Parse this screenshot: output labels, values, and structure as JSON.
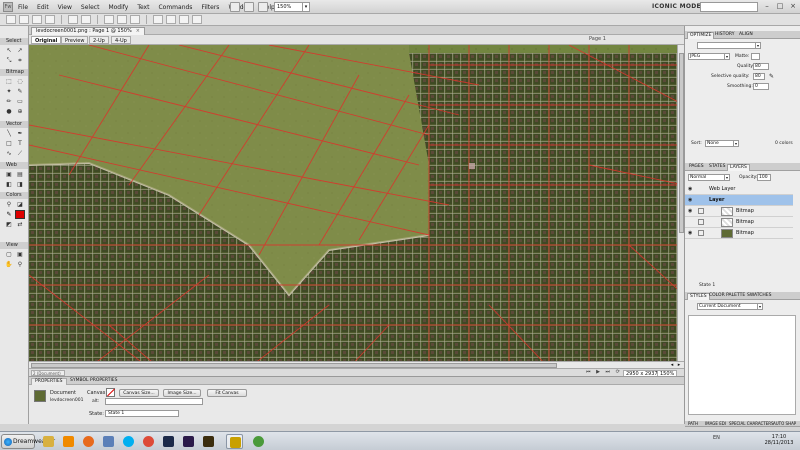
{
  "menubar": {
    "logo": "Fw",
    "items": [
      "File",
      "Edit",
      "View",
      "Select",
      "Modify",
      "Text",
      "Commands",
      "Filters",
      "Window",
      "Help"
    ],
    "zoom": "150%",
    "workspace": "ICONIC MODE"
  },
  "tools": {
    "sections": [
      "Select",
      "Bitmap",
      "Vector",
      "Web",
      "Colors",
      "View"
    ]
  },
  "document": {
    "tab_title": "levdocreen0001.png : Page 1 @ 150%",
    "view_tabs": [
      "Original",
      "Preview",
      "2-Up",
      "4-Up"
    ],
    "page": "Page 1",
    "status_field": "2 (Document)",
    "dimensions": "2950 x 2937",
    "zoom": "150%"
  },
  "properties": {
    "tabs": [
      "PROPERTIES",
      "SYMBOL PROPERTIES"
    ],
    "doc_label": "Document",
    "doc_name": "levdocreen001",
    "canvas_label": "Canvas:",
    "canvas_size_btn": "Canvas Size...",
    "image_size_btn": "Image Size...",
    "fit_canvas_btn": "Fit Canvas",
    "state_label": "State:",
    "state_value": "State 1"
  },
  "optimize": {
    "tabs": [
      "OPTIMIZE",
      "HISTORY",
      "ALIGN"
    ],
    "format": "JPEG",
    "matte_label": "Matte:",
    "quality_label": "Quality:",
    "quality_value": "80",
    "selective_label": "Selective quality:",
    "selective_value": "80",
    "smoothing_label": "Smoothing:",
    "smoothing_value": "0",
    "sort_label": "Sort:",
    "sort_value": "None",
    "colors": "0 colors"
  },
  "layers": {
    "tabs": [
      "PAGES",
      "STATES",
      "LAYERS"
    ],
    "blend": "Normal",
    "opacity_label": "Opacity:",
    "opacity_value": "100",
    "rows": [
      {
        "name": "Web Layer"
      },
      {
        "name": "Layer"
      },
      {
        "name": "Bitmap"
      },
      {
        "name": "Bitmap"
      },
      {
        "name": "Bitmap"
      }
    ],
    "state_footer": "State 1"
  },
  "styles": {
    "tabs": [
      "STYLES",
      "COLOR PALETTE",
      "SWATCHES"
    ],
    "select": "Current Document"
  },
  "bottom_tabs": [
    "PATH",
    "IMAGE EDI",
    "SPECIAL CHARACTERS",
    "AUTO SHAP"
  ],
  "taskbar": {
    "start": "Dreamweaver",
    "time": "17:10",
    "date": "28/11/2013",
    "tray": "EN"
  },
  "colors": {
    "accent_blue": "#1662b4",
    "road_red": "#d8362c",
    "field_green": "#6b7d3a"
  }
}
